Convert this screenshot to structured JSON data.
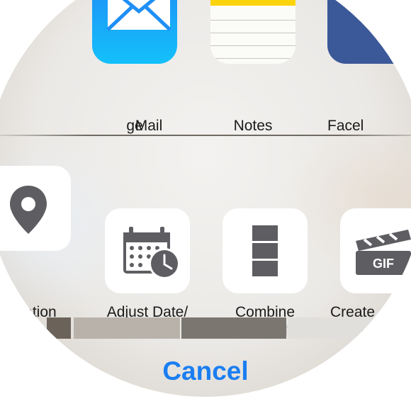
{
  "share_row": {
    "items": [
      {
        "label": "ge",
        "icon": "message-icon"
      },
      {
        "label": "Mail",
        "icon": "mail-icon"
      },
      {
        "label": "Notes",
        "icon": "notes-icon"
      },
      {
        "label": "Facel",
        "icon": "facebook-icon"
      }
    ]
  },
  "action_row": {
    "items": [
      {
        "label": "Location",
        "icon": "location-pin-icon"
      },
      {
        "label": "Adjust Date/\nTime",
        "icon": "calendar-clock-icon"
      },
      {
        "label": "Combine\nVertically",
        "icon": "stack-vertical-icon"
      },
      {
        "label": "Create\nAnimate",
        "icon": "gif-clapperboard-icon"
      }
    ]
  },
  "cancel_label": "Cancel",
  "colors": {
    "accent": "#1b7ef2",
    "mail_gradient_top": "#1f8ff5",
    "mail_gradient_bottom": "#14c0fb",
    "notes_yellow": "#fdd40b",
    "facebook_blue": "#3b5998",
    "action_icon_gray": "#5d5d62"
  }
}
